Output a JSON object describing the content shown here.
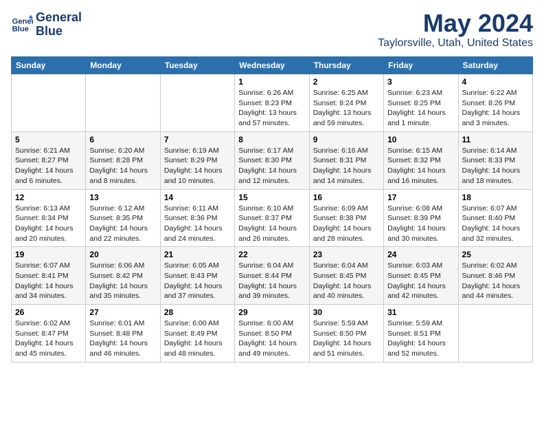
{
  "header": {
    "logo_line1": "General",
    "logo_line2": "Blue",
    "month_year": "May 2024",
    "location": "Taylorsville, Utah, United States"
  },
  "weekdays": [
    "Sunday",
    "Monday",
    "Tuesday",
    "Wednesday",
    "Thursday",
    "Friday",
    "Saturday"
  ],
  "weeks": [
    [
      {
        "day": "",
        "info": ""
      },
      {
        "day": "",
        "info": ""
      },
      {
        "day": "",
        "info": ""
      },
      {
        "day": "1",
        "info": "Sunrise: 6:26 AM\nSunset: 8:23 PM\nDaylight: 13 hours and 57 minutes."
      },
      {
        "day": "2",
        "info": "Sunrise: 6:25 AM\nSunset: 8:24 PM\nDaylight: 13 hours and 59 minutes."
      },
      {
        "day": "3",
        "info": "Sunrise: 6:23 AM\nSunset: 8:25 PM\nDaylight: 14 hours and 1 minute."
      },
      {
        "day": "4",
        "info": "Sunrise: 6:22 AM\nSunset: 8:26 PM\nDaylight: 14 hours and 3 minutes."
      }
    ],
    [
      {
        "day": "5",
        "info": "Sunrise: 6:21 AM\nSunset: 8:27 PM\nDaylight: 14 hours and 6 minutes."
      },
      {
        "day": "6",
        "info": "Sunrise: 6:20 AM\nSunset: 8:28 PM\nDaylight: 14 hours and 8 minutes."
      },
      {
        "day": "7",
        "info": "Sunrise: 6:19 AM\nSunset: 8:29 PM\nDaylight: 14 hours and 10 minutes."
      },
      {
        "day": "8",
        "info": "Sunrise: 6:17 AM\nSunset: 8:30 PM\nDaylight: 14 hours and 12 minutes."
      },
      {
        "day": "9",
        "info": "Sunrise: 6:16 AM\nSunset: 8:31 PM\nDaylight: 14 hours and 14 minutes."
      },
      {
        "day": "10",
        "info": "Sunrise: 6:15 AM\nSunset: 8:32 PM\nDaylight: 14 hours and 16 minutes."
      },
      {
        "day": "11",
        "info": "Sunrise: 6:14 AM\nSunset: 8:33 PM\nDaylight: 14 hours and 18 minutes."
      }
    ],
    [
      {
        "day": "12",
        "info": "Sunrise: 6:13 AM\nSunset: 8:34 PM\nDaylight: 14 hours and 20 minutes."
      },
      {
        "day": "13",
        "info": "Sunrise: 6:12 AM\nSunset: 8:35 PM\nDaylight: 14 hours and 22 minutes."
      },
      {
        "day": "14",
        "info": "Sunrise: 6:11 AM\nSunset: 8:36 PM\nDaylight: 14 hours and 24 minutes."
      },
      {
        "day": "15",
        "info": "Sunrise: 6:10 AM\nSunset: 8:37 PM\nDaylight: 14 hours and 26 minutes."
      },
      {
        "day": "16",
        "info": "Sunrise: 6:09 AM\nSunset: 8:38 PM\nDaylight: 14 hours and 28 minutes."
      },
      {
        "day": "17",
        "info": "Sunrise: 6:08 AM\nSunset: 8:39 PM\nDaylight: 14 hours and 30 minutes."
      },
      {
        "day": "18",
        "info": "Sunrise: 6:07 AM\nSunset: 8:40 PM\nDaylight: 14 hours and 32 minutes."
      }
    ],
    [
      {
        "day": "19",
        "info": "Sunrise: 6:07 AM\nSunset: 8:41 PM\nDaylight: 14 hours and 34 minutes."
      },
      {
        "day": "20",
        "info": "Sunrise: 6:06 AM\nSunset: 8:42 PM\nDaylight: 14 hours and 35 minutes."
      },
      {
        "day": "21",
        "info": "Sunrise: 6:05 AM\nSunset: 8:43 PM\nDaylight: 14 hours and 37 minutes."
      },
      {
        "day": "22",
        "info": "Sunrise: 6:04 AM\nSunset: 8:44 PM\nDaylight: 14 hours and 39 minutes."
      },
      {
        "day": "23",
        "info": "Sunrise: 6:04 AM\nSunset: 8:45 PM\nDaylight: 14 hours and 40 minutes."
      },
      {
        "day": "24",
        "info": "Sunrise: 6:03 AM\nSunset: 8:45 PM\nDaylight: 14 hours and 42 minutes."
      },
      {
        "day": "25",
        "info": "Sunrise: 6:02 AM\nSunset: 8:46 PM\nDaylight: 14 hours and 44 minutes."
      }
    ],
    [
      {
        "day": "26",
        "info": "Sunrise: 6:02 AM\nSunset: 8:47 PM\nDaylight: 14 hours and 45 minutes."
      },
      {
        "day": "27",
        "info": "Sunrise: 6:01 AM\nSunset: 8:48 PM\nDaylight: 14 hours and 46 minutes."
      },
      {
        "day": "28",
        "info": "Sunrise: 6:00 AM\nSunset: 8:49 PM\nDaylight: 14 hours and 48 minutes."
      },
      {
        "day": "29",
        "info": "Sunrise: 6:00 AM\nSunset: 8:50 PM\nDaylight: 14 hours and 49 minutes."
      },
      {
        "day": "30",
        "info": "Sunrise: 5:59 AM\nSunset: 8:50 PM\nDaylight: 14 hours and 51 minutes."
      },
      {
        "day": "31",
        "info": "Sunrise: 5:59 AM\nSunset: 8:51 PM\nDaylight: 14 hours and 52 minutes."
      },
      {
        "day": "",
        "info": ""
      }
    ]
  ]
}
